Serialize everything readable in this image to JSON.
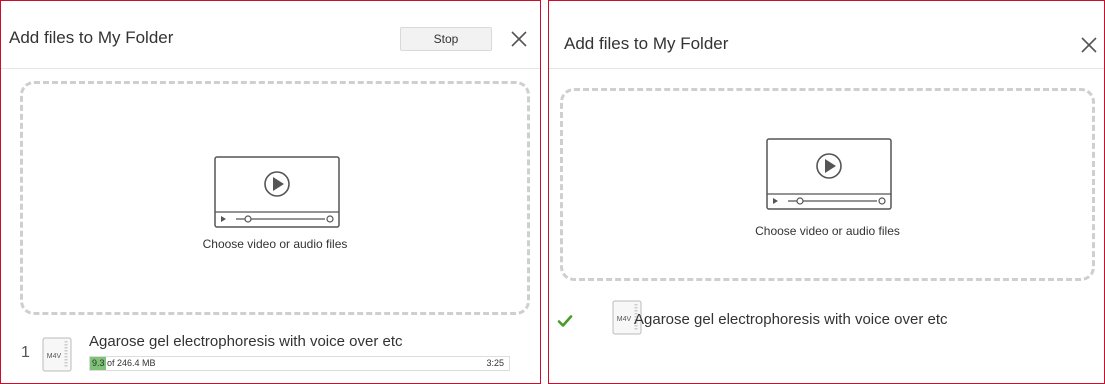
{
  "colors": {
    "panel_border": "#c8102e",
    "progress_fill": "#7dc277",
    "check": "#4c9a2a",
    "dropzone_border": "#cfcfcf"
  },
  "left_panel": {
    "title": "Add files to My Folder",
    "stop_label": "Stop",
    "close_icon": "close-icon",
    "dropzone": {
      "icon": "video-player-icon",
      "label": "Choose video or audio files"
    },
    "file": {
      "index": "1",
      "icon": "m4v-file-icon",
      "icon_label": "M4V",
      "name": "Agarose gel electrophoresis with voice over etc",
      "progress_text": "9.3 of 246.4 MB",
      "progress_fraction": 0.038,
      "time_remaining": "3:25"
    }
  },
  "right_panel": {
    "title": "Add files to My Folder",
    "close_icon": "close-icon",
    "dropzone": {
      "icon": "video-player-icon",
      "label": "Choose video or audio files"
    },
    "file": {
      "status_icon": "checkmark-icon",
      "icon": "m4v-file-icon",
      "icon_label": "M4V",
      "name": "Agarose gel electrophoresis with voice over etc"
    }
  }
}
